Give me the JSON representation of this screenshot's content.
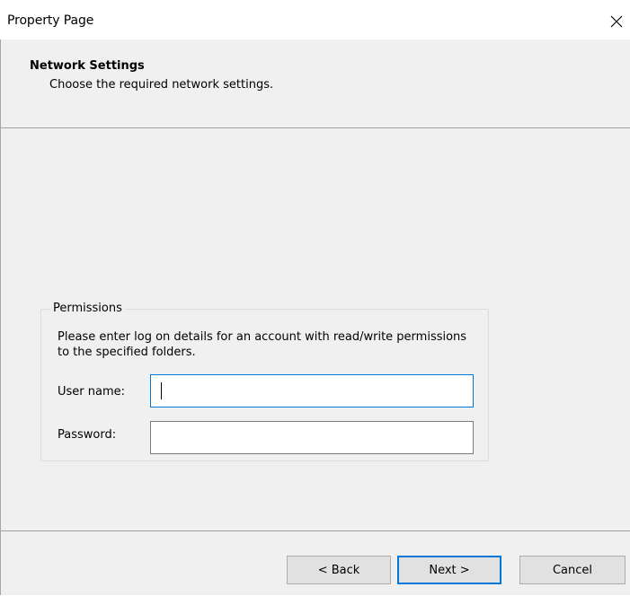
{
  "window": {
    "title": "Property Page"
  },
  "header": {
    "title": "Network Settings",
    "subtitle": "Choose the required network settings."
  },
  "permissions": {
    "legend": "Permissions",
    "description": "Please enter log on details for an account with read/write permissions to the specified folders.",
    "username_label": "User name:",
    "username_value": "",
    "password_label": "Password:",
    "password_value": ""
  },
  "buttons": {
    "back": "< Back",
    "next": "Next >",
    "cancel": "Cancel"
  },
  "icons": {
    "close": "close-icon"
  },
  "colors": {
    "focus_accent": "#0078d7",
    "dialog_bg": "#f0f0f0"
  }
}
